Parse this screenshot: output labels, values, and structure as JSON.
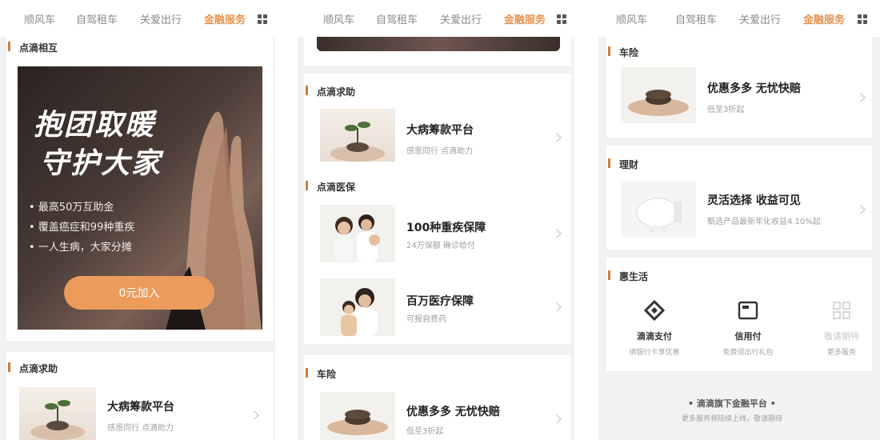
{
  "tabs": [
    "顺风车",
    "自驾租车",
    "关爱出行",
    "金融服务"
  ],
  "panel1": {
    "section_mutual": "点滴相互",
    "banner": {
      "headline_line1": "抱团取暖",
      "headline_line2": "守护大家",
      "bullets": [
        "• 最高50万互助金",
        "• 覆盖癌症和99种重疾",
        "• 一人生病，大家分摊"
      ],
      "join_label": "0元加入"
    },
    "section_help": "点滴求助",
    "help_item": {
      "title": "大病筹款平台",
      "subtitle": "感恩同行 点滴助力"
    }
  },
  "panel2": {
    "section_help": "点滴求助",
    "help_item": {
      "title": "大病筹款平台",
      "subtitle": "感恩同行 点滴助力"
    },
    "section_medical": "点滴医保",
    "medical_items": [
      {
        "title": "100种重疾保障",
        "subtitle": "24万保额 确诊给付"
      },
      {
        "title": "百万医疗保障",
        "subtitle": "可报自费药"
      }
    ],
    "section_car": "车险",
    "car_item": {
      "title": "优惠多多 无忧快赔",
      "subtitle": "低至3折起"
    }
  },
  "panel3": {
    "section_car": "车险",
    "car_item": {
      "title": "优惠多多 无忧快赔",
      "subtitle": "低至3折起"
    },
    "section_finance": "理财",
    "finance_item": {
      "title": "灵活选择 收益可见",
      "subtitle": "甄选产品最新年化收益4.10%起"
    },
    "section_life": "惠生活",
    "life_buttons": [
      {
        "label": "滴滴支付",
        "sub": "绑银行卡享优惠"
      },
      {
        "label": "信用付",
        "sub": "免费领出行礼包"
      },
      {
        "label": "敬请期待",
        "sub": "更多服务"
      }
    ],
    "footer_title": "• 滴滴旗下金融平台 •",
    "footer_sub": "更多服务将陆续上线，敬请期待"
  },
  "colors": {
    "accent": "#e7934f",
    "button": "#eb9c5c",
    "section_mark": "#d07b3b",
    "page_bg": "#f2f2f2"
  }
}
